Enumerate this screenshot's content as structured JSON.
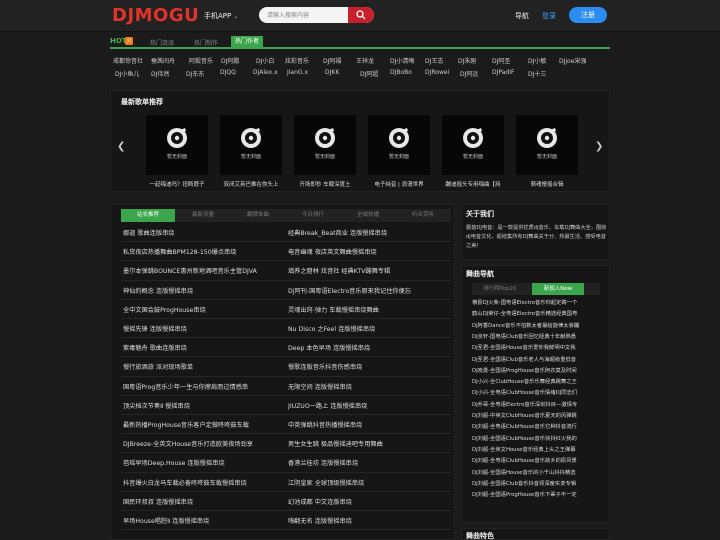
{
  "header": {
    "logo": "DJMOGU",
    "app_label": "手机APP",
    "search_placeholder": "请输入搜索内容",
    "nav_label": "导航",
    "login": "登录",
    "register": "注册"
  },
  "hot": {
    "label": "HOT",
    "icon": "火",
    "tabs": [
      "热门流派",
      "热门制作",
      "热门作者"
    ],
    "artists_row1": [
      "戒都惊音社",
      "蚕茜间舟",
      "阿毅音乐",
      "DJ阿鹏",
      "DJ小白",
      "炫彩音乐",
      "DJ阿福",
      "王祥龙",
      "DJ小清晦",
      "DJ王志",
      "DJ朱刚",
      "DJ阿圣",
      "DJ小敏",
      "DJjoe宋强"
    ],
    "artists_row2": [
      "DJ小鱼儿",
      "DJ伟然",
      "DJ东东",
      "DJQQ",
      "DjAlex.x",
      "JianG.x",
      "DJKK",
      "DJ阿超",
      "DJBoBo",
      "DJRowei",
      "DJ阿远",
      "DJPadIF",
      "DJ十三"
    ]
  },
  "new_songs": {
    "title": "最新歌单推荐",
    "cover_text": "暂无封面",
    "items": [
      "一起嗨迪吗？扭断脖子",
      "双闭艾英巴推在你头上",
      "开场即秒 车载深度土",
      "电子纯音 | 浪漫世界",
      "蹦迪摇头专用嗨曲【持",
      "萌魂慢摇合辑"
    ]
  },
  "lists": {
    "tabs": [
      "站长推荐",
      "最新流量",
      "翻牌单曲",
      "今日排行",
      "全城热播",
      "听众赏听"
    ],
    "rows": [
      [
        "娜迦 歌曲连版串烧",
        "经典Break_Beat商业 连版慢摇串烧"
      ],
      [
        "私货夜店热播舞曲BPM128-150爆点串烧",
        "电音幽魂 夜店英文舞曲慢摇串烧"
      ],
      [
        "墨尔本弹跳BOUNCE惠州新地酒吧音乐主管DJVA",
        "填荞之窟林 炫音社 经典KTV蹦舞专辑"
      ],
      [
        "神仙的概念 连版慢摇串烧",
        "Dj阿刊-国粤语Electro音乐原来我记住你便忘"
      ],
      [
        "全中文国会鼓ProgHouse串烧",
        "灵魂出窍-弹力 车载慢摇串烧舞曲"
      ],
      [
        "慢摇先锋 连版慢摇串烧",
        "Nu Disco 之Feel 连版慢摇串烧"
      ],
      [
        "紫毒魅舟 歌曲连版串烧",
        "Deep 本色早场 连版慢摇串烧"
      ],
      [
        "慢行旅酒旅 派对现场歌单",
        "慢歌连版音乐抖音伤感串烧"
      ],
      [
        "国粤语Prog音乐少年一生与你擦肩而过情感串",
        "无限空间 连版慢摇串烧"
      ],
      [
        "顶尖档次节奏Ⅱ 慢摇串烧",
        "JIUZUO一路上 连版慢摇串烧"
      ],
      [
        "最新热播ProgHouse音乐客户定做咚咚鼓车载",
        "中英弹跳抖音热播慢摇串烧"
      ],
      [
        "DJBreeze-全英文House音乐打造欧美夜场劲享",
        "男生女生跳 极品慢摇迪吧专用舞曲"
      ],
      [
        "芭瑶早场Deep.House 连版慢摇串烧",
        "香港兰桂坊 连版慢摇串烧"
      ],
      [
        "抖音爆火白龙马车载必备咚咚鼓车载慢摇串烧",
        "江阴皇家 全球顶级慢摇串烧"
      ],
      [
        "国民环叔叔 连版慢摇串烧",
        "幻池成都 中文连版串烧"
      ],
      [
        "早场House唱腔Ⅱ 连版慢摇串烧",
        "嗨翻无名 连版慢摇串烧"
      ]
    ]
  },
  "about": {
    "title": "关于我们",
    "text": "蘑菇DJ电音：是一款提供优质dj音乐、车载DJ舞曲大全，围绕dj电音文化，超结集所有DJ舞曲关于分、热最生活、感受电音之美！"
  },
  "nav": {
    "title": "舞曲导航",
    "tabs": [
      "排行榜Top20",
      "新加入New"
    ],
    "items": [
      "横县DJ火柴-国粤语Electro音乐仰起定睛一个",
      "鹤山DJ荣仔-全粤语Electro音乐精选经典国粤",
      "Dj阿香Dance音乐不怕数太者最给旋律太浪蹦",
      "Dj京轩-国粤语Club音乐回忆经典十年献熟悉",
      "Dj圣君-全国语House音乐爱你我鲜明中文我",
      "Dj圣君-全国语Club音乐老人与海超级重低音",
      "Dj晓勇-全国语ProgHouse音乐阿衣莫及时间",
      "Dj小兴-全ClubHouse音乐乐舞经典跳舞之王",
      "Dj小兴-全粤语ClubHouse音乐情绪DJ同志们",
      "Dj乔哥-全粤语Electro音乐深圳抖目—激情专",
      "Dj刘超-中英文ClubHouse音乐夏天的风弹跳",
      "Dj刘超-全粤语ClubHouse音乐它种抖音流行",
      "Dj刘超-全国语ClubHouse音乐快抖红火我的",
      "Dj刘超-全英文House音乐经典上头之王弹幕",
      "Dj刘超-全粤语ClubHouse音乐故乡的原风景",
      "Dj刘超-全国语House音乐的小千山抖抖精选",
      "Dj刘超-全国语Club音乐抖音领深度实变专辑",
      "Dj刘超-全国语ProgHouse音乐下辈子不一定"
    ]
  },
  "feature": {
    "title": "舞曲特色"
  }
}
